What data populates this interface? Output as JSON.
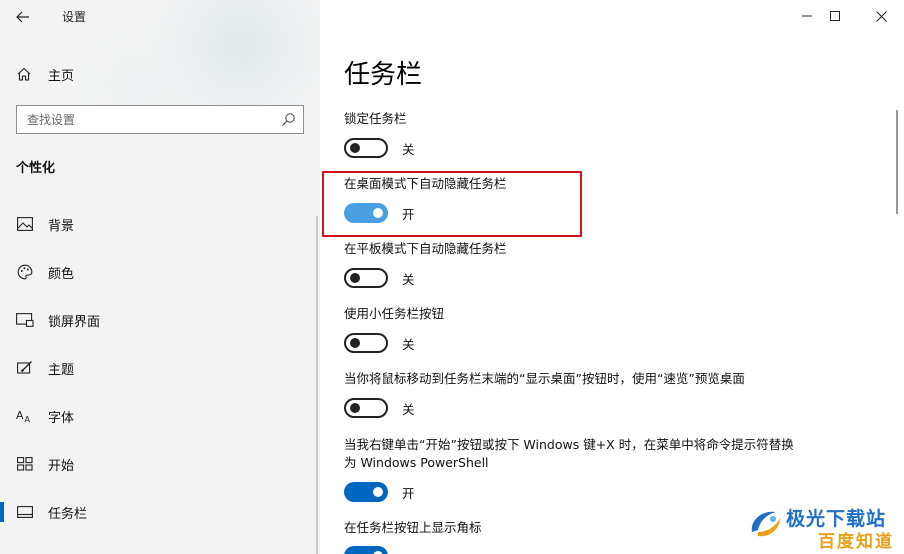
{
  "app": {
    "title": "设置"
  },
  "sidebar": {
    "home_label": "主页",
    "search_placeholder": "查找设置",
    "section_title": "个性化",
    "items": [
      {
        "label": "背景",
        "icon": "picture-icon"
      },
      {
        "label": "颜色",
        "icon": "palette-icon"
      },
      {
        "label": "锁屏界面",
        "icon": "lock-screen-icon"
      },
      {
        "label": "主题",
        "icon": "theme-brush-icon"
      },
      {
        "label": "字体",
        "icon": "font-icon"
      },
      {
        "label": "开始",
        "icon": "start-grid-icon"
      },
      {
        "label": "任务栏",
        "icon": "taskbar-icon",
        "active": true
      }
    ]
  },
  "main": {
    "title": "任务栏",
    "settings": [
      {
        "label": "锁定任务栏",
        "state": "关",
        "on": false
      },
      {
        "label": "在桌面模式下自动隐藏任务栏",
        "state": "开",
        "on": true,
        "highlighted": true
      },
      {
        "label": "在平板模式下自动隐藏任务栏",
        "state": "关",
        "on": false
      },
      {
        "label": "使用小任务栏按钮",
        "state": "关",
        "on": false
      },
      {
        "label": "当你将鼠标移动到任务栏末端的“显示桌面”按钮时，使用“速览”预览桌面",
        "state": "关",
        "on": false
      },
      {
        "label": "当我右键单击“开始”按钮或按下 Windows 键+X 时，在菜单中将命令提示符替换为 Windows PowerShell",
        "state": "开",
        "on": true
      },
      {
        "label": "在任务栏按钮上显示角标",
        "state": "",
        "on": true
      }
    ]
  },
  "watermark": {
    "line1": "极光下载站",
    "line2": "百度知道"
  },
  "colors": {
    "accent": "#0067c0",
    "highlight_border": "#d0161d"
  }
}
